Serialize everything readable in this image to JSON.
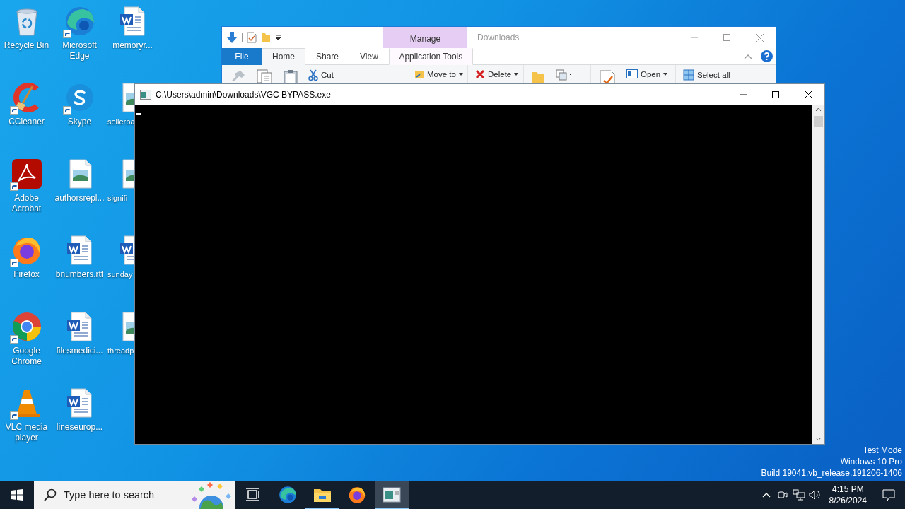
{
  "desktop_icons": [
    {
      "label": "Recycle Bin",
      "kind": "recycle",
      "shortcut": false,
      "covered": false
    },
    {
      "label": "CCleaner",
      "kind": "ccleaner",
      "shortcut": true,
      "covered": false
    },
    {
      "label": "Adobe Acrobat",
      "kind": "acrobat",
      "shortcut": true,
      "covered": false
    },
    {
      "label": "Firefox",
      "kind": "firefox",
      "shortcut": true,
      "covered": false
    },
    {
      "label": "Google Chrome",
      "kind": "chrome",
      "shortcut": true,
      "covered": false
    },
    {
      "label": "VLC media player",
      "kind": "vlc",
      "shortcut": true,
      "covered": false
    },
    {
      "label": "Microsoft Edge",
      "kind": "edge",
      "shortcut": true,
      "covered": false
    },
    {
      "label": "Skype",
      "kind": "skype",
      "shortcut": true,
      "covered": false
    },
    {
      "label": "authorsrepl...",
      "kind": "image",
      "shortcut": false,
      "covered": false
    },
    {
      "label": "bnumbers.rtf",
      "kind": "word",
      "shortcut": false,
      "covered": false
    },
    {
      "label": "filesmedici...",
      "kind": "word",
      "shortcut": false,
      "covered": false
    },
    {
      "label": "lineseurop...",
      "kind": "word",
      "shortcut": false,
      "covered": false
    },
    {
      "label": "memoryr...",
      "kind": "word",
      "shortcut": false,
      "covered": false
    },
    {
      "label": "sellerba",
      "kind": "image",
      "shortcut": false,
      "covered": true
    },
    {
      "label": "signifi",
      "kind": "image",
      "shortcut": false,
      "covered": true
    },
    {
      "label": "sunday",
      "kind": "word",
      "shortcut": false,
      "covered": true
    },
    {
      "label": "threadp",
      "kind": "image",
      "shortcut": false,
      "covered": true
    }
  ],
  "explorer": {
    "title": "Downloads",
    "context_tab": "Manage",
    "tabs": [
      {
        "label": "File",
        "kind": "file",
        "selected": false
      },
      {
        "label": "Home",
        "kind": "tab",
        "selected": true
      },
      {
        "label": "Share",
        "kind": "tab",
        "selected": false
      },
      {
        "label": "View",
        "kind": "tab",
        "selected": false
      },
      {
        "label": "Application Tools",
        "kind": "context",
        "selected": false
      }
    ],
    "ribbon_groups": [
      [
        {
          "kind": "pin"
        },
        {
          "kind": "copy"
        },
        {
          "kind": "paste"
        },
        {
          "kind": "cut",
          "label": "Cut",
          "dropdown": false
        }
      ],
      [
        {
          "kind": "move",
          "label": "Move to",
          "dropdown": true
        }
      ],
      [
        {
          "kind": "delete",
          "label": "Delete",
          "dropdown": true
        }
      ],
      [
        {
          "kind": "folder"
        },
        {
          "kind": "copyto"
        }
      ],
      [
        {
          "kind": "properties"
        },
        {
          "kind": "open",
          "label": "Open",
          "dropdown": true
        }
      ],
      [
        {
          "kind": "selectall",
          "label": "Select all",
          "dropdown": false
        }
      ]
    ]
  },
  "console": {
    "title": "C:\\Users\\admin\\Downloads\\VGC BYPASS.exe"
  },
  "desktop_notice": [
    "Test Mode",
    "Windows 10 Pro",
    "Build 19041.vb_release.191206-1406"
  ],
  "taskbar": {
    "search": {
      "placeholder": "Type here to search"
    },
    "apps": [
      {
        "kind": "taskview",
        "running": false,
        "selected": false
      },
      {
        "kind": "edge",
        "running": false,
        "selected": false
      },
      {
        "kind": "explorer",
        "running": true,
        "selected": false
      },
      {
        "kind": "firefox",
        "running": false,
        "selected": false
      },
      {
        "kind": "console",
        "running": true,
        "selected": true
      }
    ],
    "clock": {
      "time": "4:15 PM",
      "date": "8/26/2024"
    }
  }
}
